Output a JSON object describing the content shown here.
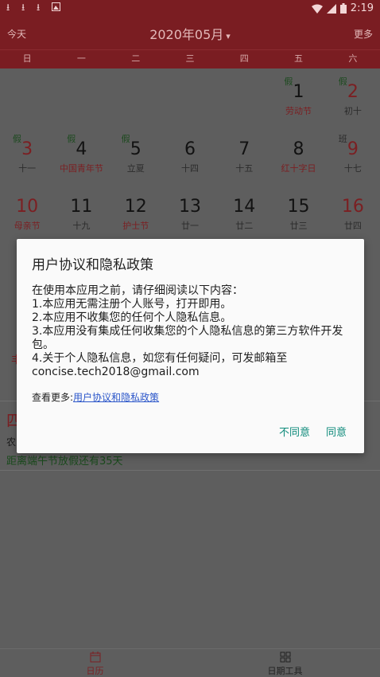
{
  "status_bar": {
    "time": "2:19",
    "icons": [
      "download-icon",
      "download-icon",
      "download-icon",
      "image-notification-icon",
      "wifi-icon",
      "signal-icon",
      "battery-icon"
    ]
  },
  "header": {
    "today": "今天",
    "title": "2020年05月",
    "caret": "▾",
    "more": "更多"
  },
  "weekdays": [
    "日",
    "一",
    "二",
    "三",
    "四",
    "五",
    "六"
  ],
  "rows": [
    [
      {
        "tag": "",
        "num": "",
        "lunar": ""
      },
      {
        "tag": "",
        "num": "",
        "lunar": ""
      },
      {
        "tag": "",
        "num": "",
        "lunar": ""
      },
      {
        "tag": "",
        "num": "",
        "lunar": ""
      },
      {
        "tag": "",
        "num": "",
        "lunar": ""
      },
      {
        "tag": "假",
        "num": "1",
        "lunar": "劳动节",
        "lunar_red": true
      },
      {
        "tag": "假",
        "num": "2",
        "num_red": true,
        "lunar": "初十"
      }
    ],
    [
      {
        "tag": "假",
        "num": "3",
        "num_red": true,
        "lunar": "十一"
      },
      {
        "tag": "假",
        "num": "4",
        "lunar": "中国青年节",
        "lunar_red": true
      },
      {
        "tag": "假",
        "num": "5",
        "lunar": "立夏"
      },
      {
        "tag": "",
        "num": "6",
        "lunar": "十四"
      },
      {
        "tag": "",
        "num": "7",
        "lunar": "十五"
      },
      {
        "tag": "",
        "num": "8",
        "lunar": "红十字日",
        "lunar_red": true
      },
      {
        "tag": "班",
        "tag_work": true,
        "num": "9",
        "num_red": true,
        "lunar": "十七"
      }
    ],
    [
      {
        "tag": "",
        "num": "10",
        "num_red": true,
        "lunar": "母亲节",
        "lunar_red": true
      },
      {
        "tag": "",
        "num": "11",
        "lunar": "十九"
      },
      {
        "tag": "",
        "num": "12",
        "lunar": "护士节",
        "lunar_red": true
      },
      {
        "tag": "",
        "num": "13",
        "lunar": "廿一"
      },
      {
        "tag": "",
        "num": "14",
        "lunar": "廿二"
      },
      {
        "tag": "",
        "num": "15",
        "lunar": "廿三"
      },
      {
        "tag": "",
        "num": "16",
        "num_red": true,
        "lunar": "廿四"
      }
    ]
  ],
  "behind": {
    "red_fragment": "丰",
    "big_char": "四",
    "nong": "农",
    "countdown": "距离端午节放假还有35天"
  },
  "dialog": {
    "title": "用户协议和隐私政策",
    "lines": [
      "在使用本应用之前，请仔细阅读以下内容：",
      " 1.本应用无需注册个人账号，打开即用。",
      " 2.本应用不收集您的任何个人隐私信息。",
      " 3.本应用没有集成任何收集您的个人隐私信息的第三方软件开发包。",
      " 4.关于个人隐私信息，如您有任何疑问，可发邮箱至 concise.tech2018@gmail.com"
    ],
    "more_prefix": "查看更多:",
    "more_link": "用户协议和隐私政策",
    "disagree": "不同意",
    "agree": "同意"
  },
  "bottom_nav": [
    {
      "label": "日历",
      "icon": "calendar-icon",
      "active": true
    },
    {
      "label": "日期工具",
      "icon": "grid-tools-icon",
      "active": false
    }
  ]
}
